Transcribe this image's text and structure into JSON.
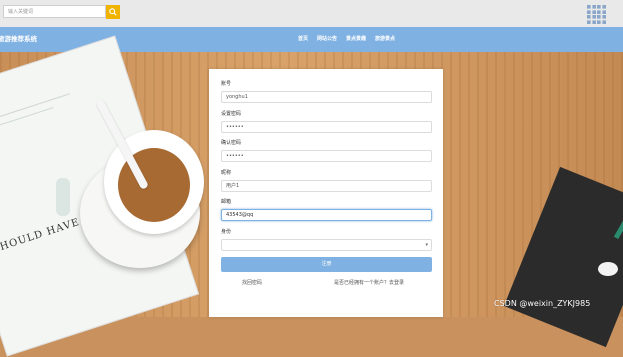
{
  "search": {
    "placeholder": "输入关键词"
  },
  "site": {
    "title": "旅游推荐系统"
  },
  "nav": {
    "items": [
      "首页",
      "网站公告",
      "景点景趣",
      "旅游景点"
    ]
  },
  "background": {
    "magazine_text": "E SHOULD HAVE A DRE"
  },
  "form": {
    "account": {
      "label": "账号",
      "value": "yonghu1"
    },
    "password": {
      "label": "设置密码",
      "value": "••••••"
    },
    "confirm_password": {
      "label": "确认密码",
      "value": "••••••"
    },
    "nickname": {
      "label": "昵称",
      "value": "用户1"
    },
    "email": {
      "label": "邮箱",
      "value": "43543@qq"
    },
    "identity": {
      "label": "身份",
      "value": ""
    },
    "submit_label": "注册",
    "forgot_link": "找回密码",
    "login_link": "是否已经拥有一个账户？去登录"
  },
  "watermark": "CSDN @weixin_ZYKJ985",
  "colors": {
    "accent": "#7fb1e3",
    "search_button": "#f0b400"
  }
}
